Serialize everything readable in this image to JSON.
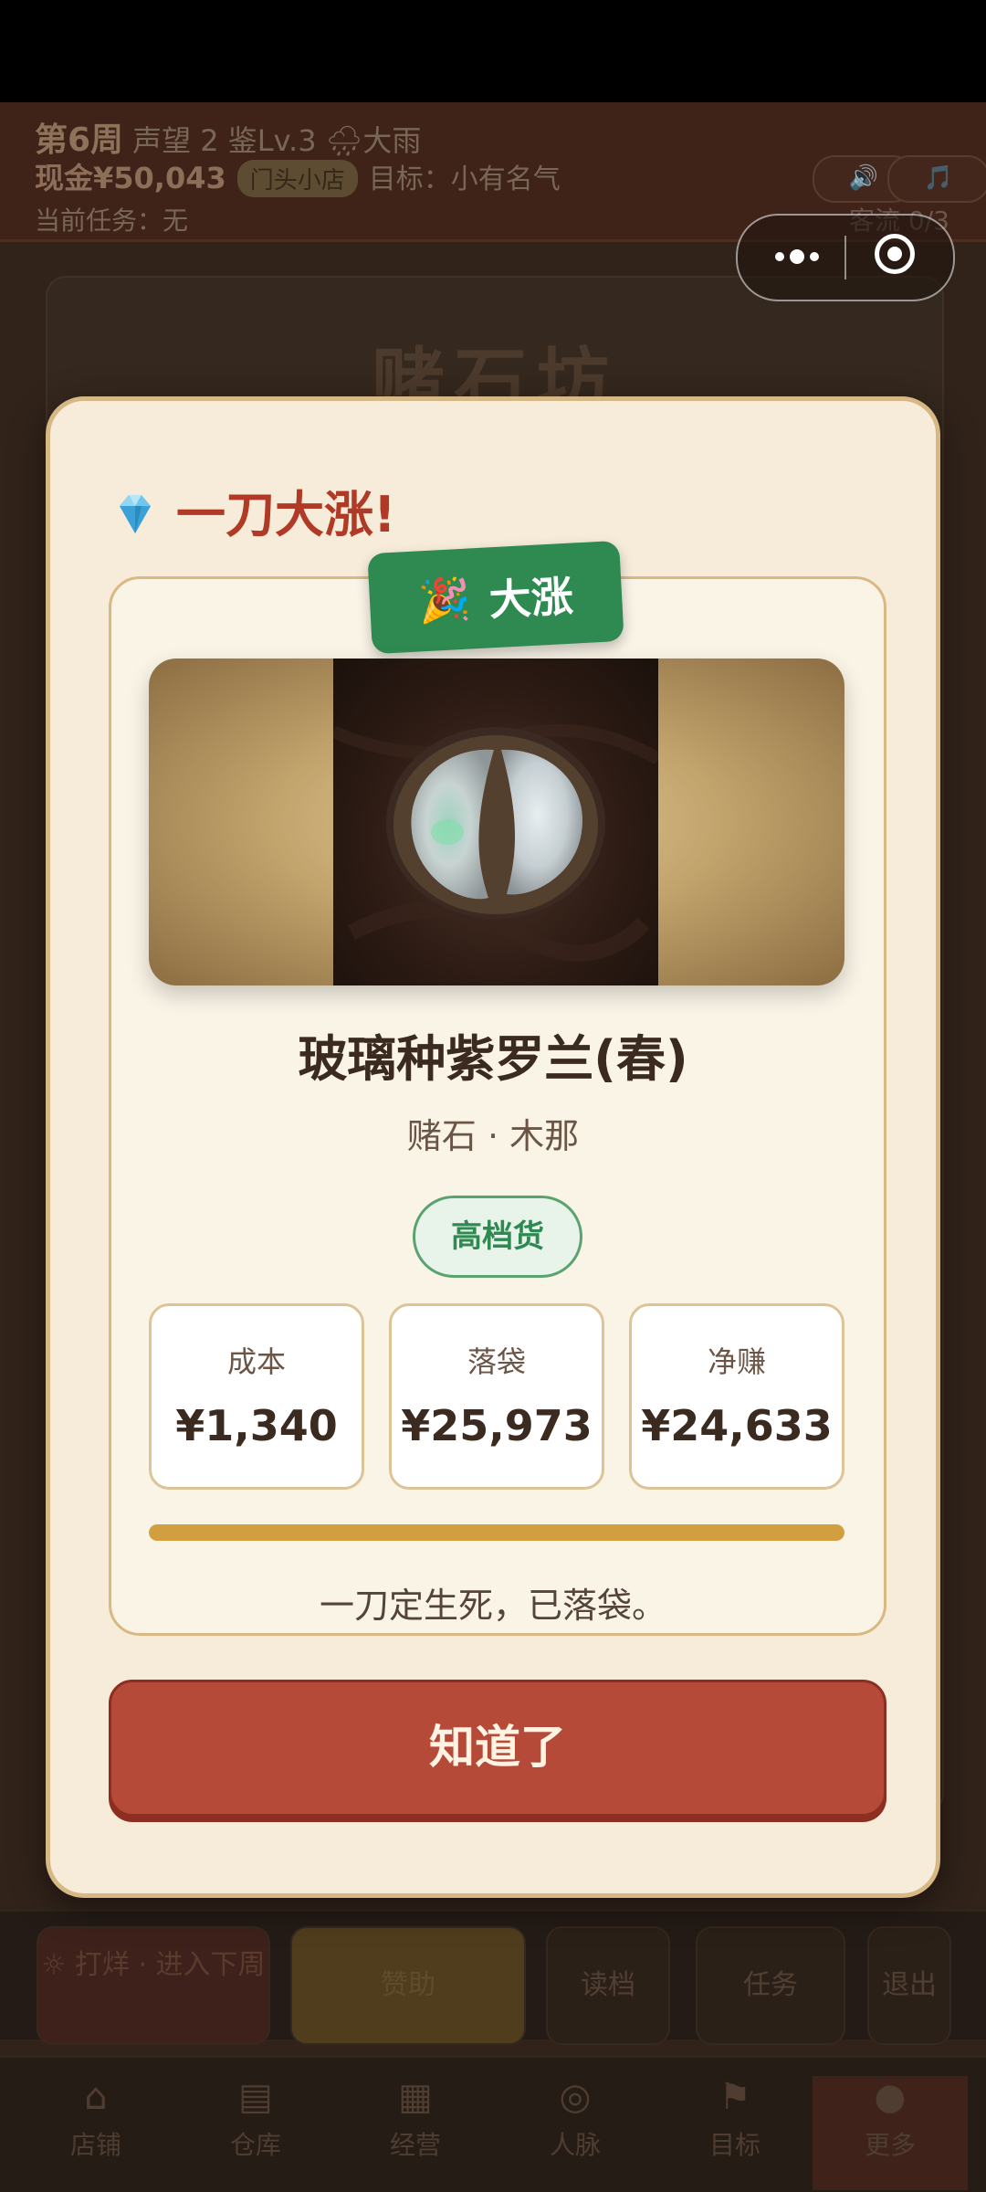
{
  "game": {
    "week": "第6周",
    "stats_line": "声望 2  鉴Lv.3  🌧大雨",
    "cash": "现金¥50,043",
    "shop_badge": "门头小店",
    "goal": "目标：小有名气",
    "task": "当前任务：无",
    "guests": "客流 0/3",
    "sound_icon": "🔊",
    "music_icon": "🎵",
    "scene_title": "赌石坊",
    "actions": {
      "close_shop": "打烊 · 进入下周",
      "sponsor": "赞助",
      "load": "读档",
      "tasks": "任务",
      "exit": "退出"
    },
    "tabs": [
      {
        "icon": "shop-icon",
        "label": "店铺"
      },
      {
        "icon": "warehouse-icon",
        "label": "仓库"
      },
      {
        "icon": "business-icon",
        "label": "经营"
      },
      {
        "icon": "people-icon",
        "label": "人脉"
      },
      {
        "icon": "goal-icon",
        "label": "目标"
      },
      {
        "icon": "more-icon",
        "label": "更多"
      }
    ]
  },
  "modal": {
    "title": "一刀大涨!",
    "ribbon_text": "大涨",
    "ribbon_emoji": "🎉",
    "item_name": "玻璃种紫罗兰(春)",
    "item_sub": "赌石 · 木那",
    "grade": "高档货",
    "stats": {
      "cost_label": "成本",
      "cost_value": "¥1,340",
      "earn_label": "落袋",
      "earn_value": "¥25,973",
      "profit_label": "净赚",
      "profit_value": "¥24,633"
    },
    "progress_percent": 100,
    "note": "一刀定生死，已落袋。",
    "ok_button": "知道了"
  },
  "colors": {
    "accent_red": "#b64a38",
    "title_red": "#b03a26",
    "green": "#2f8a52",
    "gold": "#d19f3f",
    "cream": "#f6ecd9"
  }
}
